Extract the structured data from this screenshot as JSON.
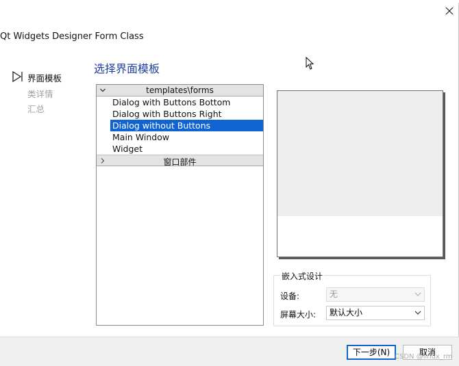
{
  "window": {
    "title": "Qt Widgets Designer Form Class"
  },
  "nav": {
    "items": [
      {
        "label": "界面模板",
        "state": "active"
      },
      {
        "label": "类详情",
        "state": "disabled"
      },
      {
        "label": "汇总",
        "state": "disabled"
      }
    ]
  },
  "main": {
    "heading": "选择界面模板",
    "tree": {
      "group1": "templates\\forms",
      "items": [
        "Dialog with Buttons Bottom",
        "Dialog with Buttons Right",
        "Dialog without Buttons",
        "Main Window",
        "Widget"
      ],
      "selected_index": 2,
      "group2": "窗口部件"
    }
  },
  "embedded": {
    "group_title": "嵌入式设计",
    "device_label": "设备:",
    "device_value": "无",
    "screen_label": "屏幕大小:",
    "screen_value": "默认大小"
  },
  "footer": {
    "next_label": "下一步(N)",
    "cancel_label": "取消",
    "watermark": "CSDN @linux_rm"
  },
  "colors": {
    "selection": "#0f64d2",
    "heading": "#1f3f9f"
  }
}
